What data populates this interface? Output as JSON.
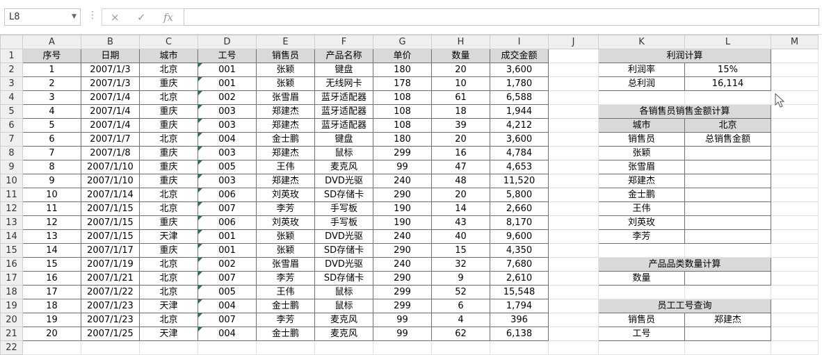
{
  "formula_bar": {
    "name_box": "L8",
    "formula": "",
    "cancel_icon": "×",
    "enter_icon": "✓",
    "fx_icon": "fx"
  },
  "columns": [
    "A",
    "B",
    "C",
    "D",
    "E",
    "F",
    "G",
    "H",
    "I",
    "J",
    "K",
    "L",
    "M"
  ],
  "row_numbers": [
    "1",
    "2",
    "3",
    "4",
    "5",
    "6",
    "7",
    "8",
    "9",
    "10",
    "11",
    "12",
    "13",
    "14",
    "15",
    "16",
    "17",
    "18",
    "19",
    "20",
    "21",
    "22"
  ],
  "table": {
    "headers": [
      "序号",
      "日期",
      "城市",
      "工号",
      "销售员",
      "产品名称",
      "单价",
      "数量",
      "成交金额"
    ],
    "rows": [
      [
        "1",
        "2007/1/3",
        "北京",
        "001",
        "张颖",
        "键盘",
        "180",
        "20",
        "3,600"
      ],
      [
        "2",
        "2007/1/3",
        "重庆",
        "001",
        "张颖",
        "无线网卡",
        "178",
        "10",
        "1,780"
      ],
      [
        "3",
        "2007/1/4",
        "北京",
        "002",
        "张雪眉",
        "蓝牙适配器",
        "108",
        "61",
        "6,588"
      ],
      [
        "4",
        "2007/1/4",
        "重庆",
        "003",
        "郑建杰",
        "蓝牙适配器",
        "108",
        "18",
        "1,944"
      ],
      [
        "5",
        "2007/1/4",
        "重庆",
        "003",
        "郑建杰",
        "蓝牙适配器",
        "108",
        "39",
        "4,212"
      ],
      [
        "6",
        "2007/1/7",
        "北京",
        "004",
        "金士鹏",
        "键盘",
        "180",
        "20",
        "3,600"
      ],
      [
        "7",
        "2007/1/8",
        "重庆",
        "003",
        "郑建杰",
        "鼠标",
        "299",
        "16",
        "4,784"
      ],
      [
        "8",
        "2007/1/10",
        "重庆",
        "005",
        "王伟",
        "麦克风",
        "99",
        "47",
        "4,653"
      ],
      [
        "9",
        "2007/1/10",
        "重庆",
        "003",
        "郑建杰",
        "DVD光驱",
        "240",
        "48",
        "11,520"
      ],
      [
        "10",
        "2007/1/14",
        "北京",
        "006",
        "刘英玫",
        "SD存储卡",
        "290",
        "20",
        "5,800"
      ],
      [
        "11",
        "2007/1/15",
        "北京",
        "007",
        "李芳",
        "手写板",
        "190",
        "14",
        "2,660"
      ],
      [
        "12",
        "2007/1/15",
        "重庆",
        "006",
        "刘英玫",
        "手写板",
        "190",
        "43",
        "8,170"
      ],
      [
        "13",
        "2007/1/15",
        "天津",
        "001",
        "张颖",
        "DVD光驱",
        "240",
        "40",
        "9,600"
      ],
      [
        "14",
        "2007/1/17",
        "重庆",
        "001",
        "张颖",
        "SD存储卡",
        "290",
        "15",
        "4,350"
      ],
      [
        "15",
        "2007/1/19",
        "北京",
        "002",
        "张雪眉",
        "DVD光驱",
        "240",
        "32",
        "7,680"
      ],
      [
        "16",
        "2007/1/21",
        "北京",
        "007",
        "李芳",
        "SD存储卡",
        "290",
        "9",
        "2,610"
      ],
      [
        "17",
        "2007/1/22",
        "北京",
        "005",
        "王伟",
        "鼠标",
        "299",
        "52",
        "15,548"
      ],
      [
        "18",
        "2007/1/23",
        "天津",
        "004",
        "金士鹏",
        "鼠标",
        "299",
        "6",
        "1,794"
      ],
      [
        "19",
        "2007/1/23",
        "北京",
        "007",
        "李芳",
        "麦克风",
        "99",
        "4",
        "396"
      ],
      [
        "20",
        "2007/1/25",
        "天津",
        "004",
        "金士鹏",
        "麦克风",
        "99",
        "62",
        "6,138"
      ]
    ]
  },
  "profit": {
    "title": "利润计算",
    "rate_label": "利润率",
    "rate_value": "15%",
    "total_label": "总利润",
    "total_value": "16,114"
  },
  "sales_by_person": {
    "title": "各销售员销售金额计算",
    "city_label": "城市",
    "city_value": "北京",
    "person_label": "销售员",
    "amount_label": "总销售金额",
    "persons": [
      "张颖",
      "张雪眉",
      "郑建杰",
      "金士鹏",
      "王伟",
      "刘英玫",
      "李芳"
    ]
  },
  "category_count": {
    "title": "产品品类数量计算",
    "count_label": "数量",
    "count_value": ""
  },
  "employee_lookup": {
    "title": "员工工号查询",
    "person_label": "销售员",
    "person_value": "郑建杰",
    "id_label": "工号",
    "id_value": ""
  }
}
